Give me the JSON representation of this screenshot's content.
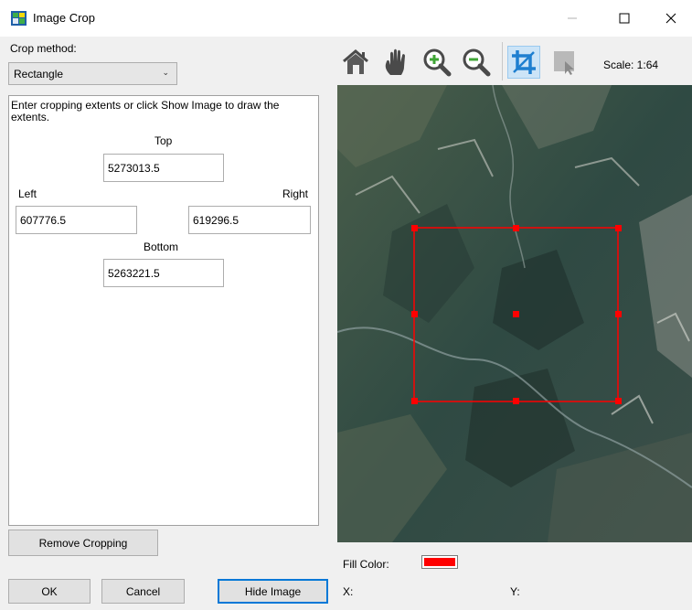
{
  "window": {
    "title": "Image Crop",
    "icon": "satellite-image-app-icon",
    "controls": [
      "minimize-icon",
      "maximize-icon",
      "close-icon"
    ]
  },
  "crop": {
    "method_label": "Crop method:",
    "method_value": "Rectangle",
    "instructions": "Enter cropping extents or click Show Image to draw the extents.",
    "top_label": "Top",
    "top_value": "5273013.5",
    "left_label": "Left",
    "left_value": "607776.5",
    "right_label": "Right",
    "right_value": "619296.5",
    "bottom_label": "Bottom",
    "bottom_value": "5263221.5"
  },
  "buttons": {
    "remove_cropping": "Remove Cropping",
    "ok": "OK",
    "cancel": "Cancel",
    "hide_image": "Hide Image"
  },
  "toolbar": {
    "tools": [
      "home-icon",
      "pan-hand-icon",
      "zoom-in-icon",
      "zoom-out-icon",
      "crop-icon",
      "select-region-icon"
    ],
    "active_tool": "crop-icon",
    "scale": "Scale: 1:64"
  },
  "map": {
    "crop_color": "#ff0000"
  },
  "status": {
    "fill_color_label": "Fill Color:",
    "fill_color": "#ff0000",
    "x_label": "X:",
    "y_label": "Y:"
  }
}
